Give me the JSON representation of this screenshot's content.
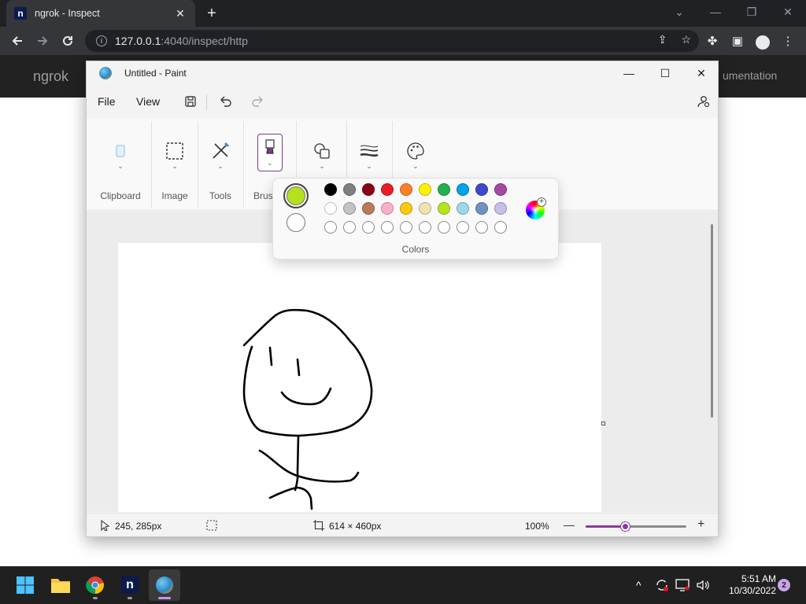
{
  "browser": {
    "tab_title": "ngrok - Inspect",
    "tab_favicon_letter": "n",
    "new_tab_label": "+",
    "url_host": "127.0.0.1",
    "url_path": ":4040/inspect/http"
  },
  "ngrok": {
    "brand": "ngrok",
    "nav_doc_partial": "umentation"
  },
  "paint": {
    "title": "Untitled - Paint",
    "menu": {
      "file": "File",
      "view": "View"
    },
    "groups": {
      "clipboard": "Clipboard",
      "image": "Image",
      "tools": "Tools",
      "brushes": "Brus"
    },
    "colors": {
      "label": "Colors",
      "primary": "#b3e11e",
      "secondary": "#ffffff",
      "palette_row1": [
        "#000000",
        "#7f7f7f",
        "#880015",
        "#ed1c24",
        "#ff7f27",
        "#fff200",
        "#22b14c",
        "#00a2e8",
        "#3f48cc",
        "#a349a4"
      ],
      "palette_row2": [
        "#ffffff",
        "#c3c3c3",
        "#b97a57",
        "#ffaec9",
        "#ffc90e",
        "#efe4b0",
        "#b5e61d",
        "#99d9ea",
        "#7092be",
        "#c8bfe7"
      ],
      "palette_row3_count": 10
    },
    "status": {
      "cursor_pos": "245, 285px",
      "canvas_size": "614 × 460px",
      "zoom": "100%",
      "zoom_fraction": 0.39
    }
  },
  "taskbar": {
    "time": "5:51 AM",
    "date": "10/30/2022",
    "notification_count": "2"
  }
}
